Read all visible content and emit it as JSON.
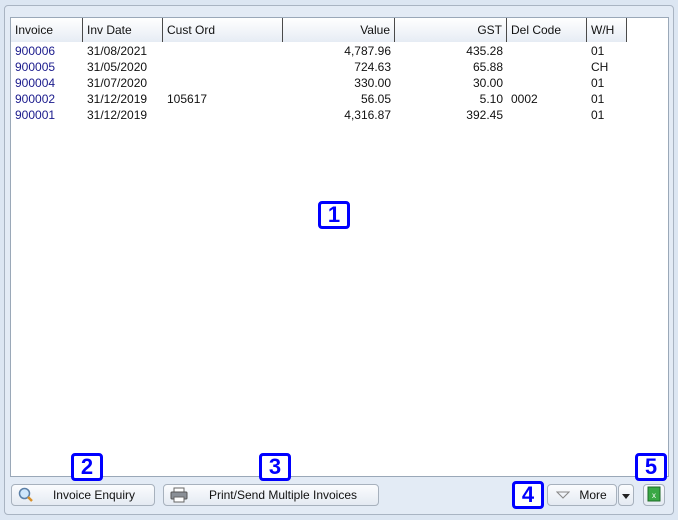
{
  "table": {
    "columns": [
      "Invoice",
      "Inv Date",
      "Cust Ord",
      "Value",
      "GST",
      "Del Code",
      "W/H"
    ],
    "rows": [
      [
        "900006",
        "31/08/2021",
        "",
        "4,787.96",
        "435.28",
        "",
        "01"
      ],
      [
        "900005",
        "31/05/2020",
        "",
        "724.63",
        "65.88",
        "",
        "CH"
      ],
      [
        "900004",
        "31/07/2020",
        "",
        "330.00",
        "30.00",
        "",
        "01"
      ],
      [
        "900002",
        "31/12/2019",
        "105617",
        "56.05",
        "5.10",
        "0002",
        "01"
      ],
      [
        "900001",
        "31/12/2019",
        "",
        "4,316.87",
        "392.45",
        "",
        "01"
      ]
    ]
  },
  "buttons": {
    "invoice_enquiry": "Invoice Enquiry",
    "print_send": "Print/Send Multiple Invoices",
    "more": "More"
  },
  "icons": {
    "invoice_enquiry": "magnifier-icon",
    "print_send": "printer-icon",
    "more": "triangle-down-icon",
    "more_dropdown": "caret-down-icon",
    "export": "excel-icon"
  },
  "callouts": [
    "1",
    "2",
    "3",
    "4",
    "5"
  ]
}
